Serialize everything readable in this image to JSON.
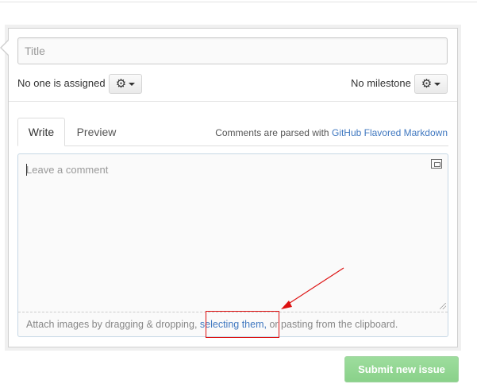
{
  "form": {
    "title_placeholder": "Title",
    "assignee_text": "No one is assigned",
    "milestone_text": "No milestone",
    "gear_icon": "gear-icon"
  },
  "tabs": {
    "write_label": "Write",
    "preview_label": "Preview",
    "markdown_hint_prefix": "Comments are parsed with",
    "markdown_link": "GitHub Flavored Markdown"
  },
  "comment": {
    "placeholder": "Leave a comment",
    "attach_prefix": "Attach images by dragging & dropping,",
    "attach_link": "selecting them,",
    "attach_suffix": "or pasting from the clipboard."
  },
  "actions": {
    "submit_label": "Submit new issue"
  },
  "colors": {
    "link": "#4078c0",
    "submit_bg": "#8ad18a",
    "annotation": "#dd1111"
  }
}
